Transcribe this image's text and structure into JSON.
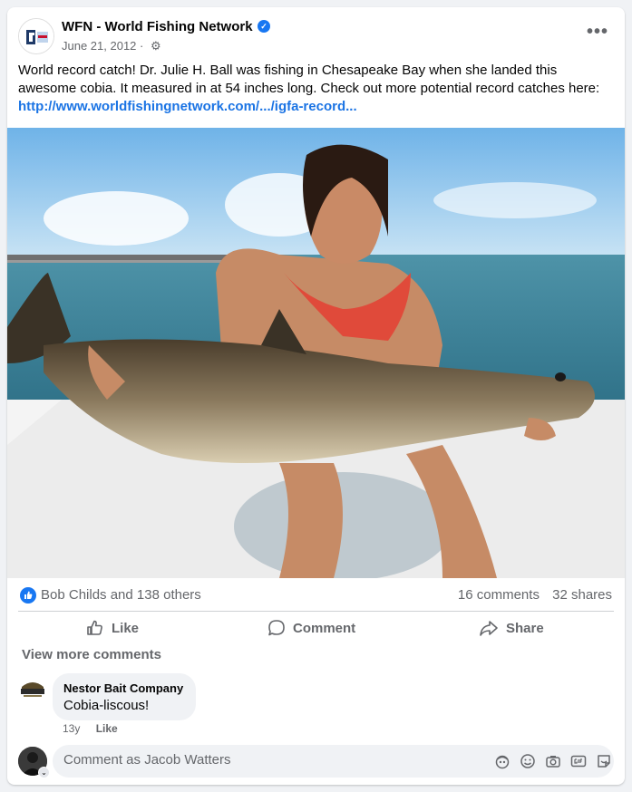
{
  "post": {
    "page_name": "WFN - World Fishing Network",
    "date": "June 21, 2012",
    "separator": "·",
    "body_text": "World record catch! Dr. Julie H. Ball was fishing in Chesapeake Bay when she landed this awesome cobia. It measured in at 54 inches long. Check out more potential record catches here:",
    "link_text": "http://www.worldfishingnetwork.com/.../igfa-record..."
  },
  "stats": {
    "reactors": "Bob Childs and 138 others",
    "comments": "16 comments",
    "shares": "32 shares"
  },
  "actions": {
    "like": "Like",
    "comment": "Comment",
    "share": "Share"
  },
  "comments": {
    "view_more": "View more comments",
    "items": [
      {
        "author": "Nestor Bait Company",
        "text": "Cobia-liscous!",
        "age": "13y",
        "like": "Like"
      }
    ]
  },
  "composer": {
    "placeholder": "Comment as Jacob Watters"
  },
  "colors": {
    "accent": "#1877f2",
    "link": "#1b74e4",
    "muted": "#65676b",
    "bubble": "#f0f2f5"
  },
  "icons": {
    "verified": "verified-badge-icon",
    "audience": "gear-icon",
    "more": "more-options-icon",
    "like": "thumbs-up-icon",
    "comment": "speech-bubble-icon",
    "share": "share-arrow-icon",
    "composer": [
      "avatar-sticker-icon",
      "emoji-icon",
      "camera-icon",
      "gif-icon",
      "sticker-icon"
    ]
  }
}
